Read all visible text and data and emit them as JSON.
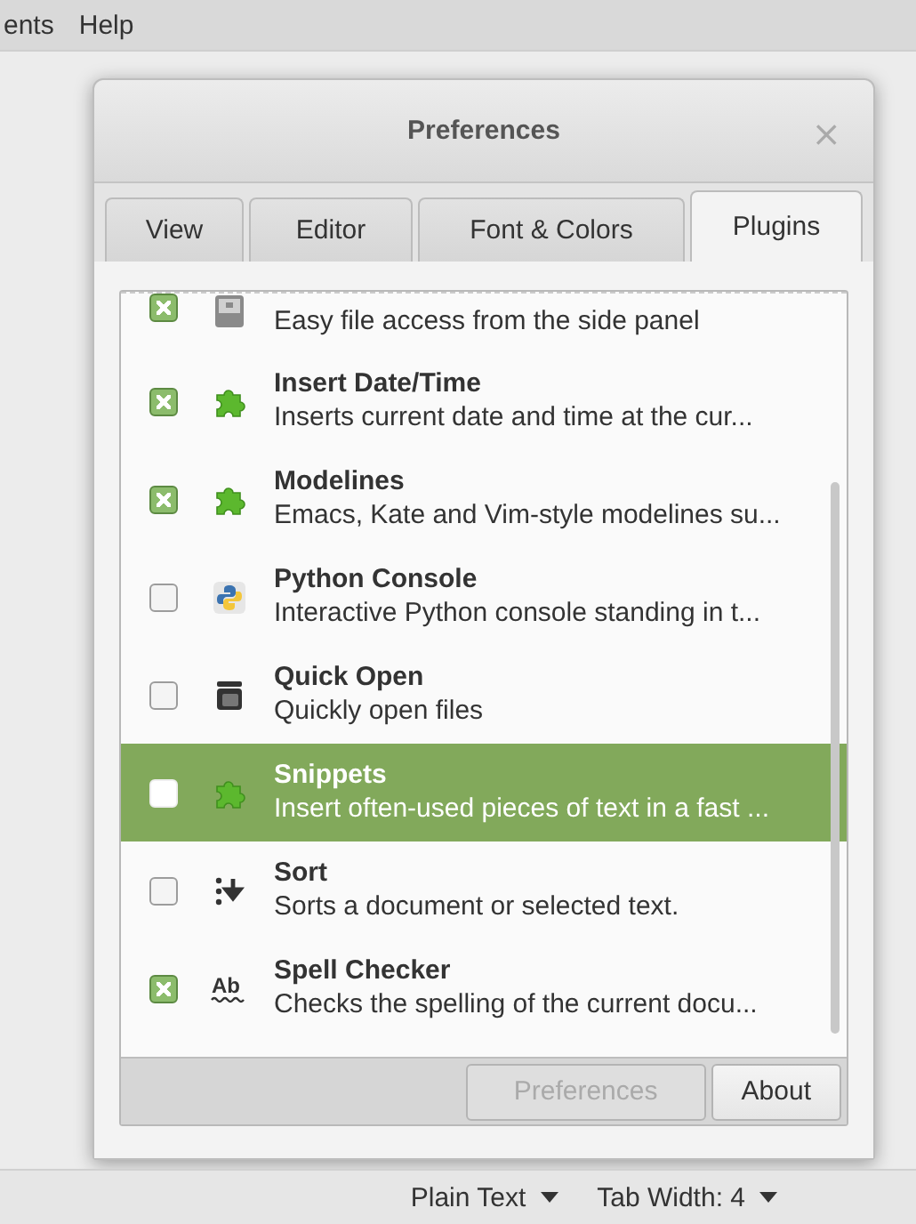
{
  "menu_bar": {
    "items": [
      "ents",
      "Help"
    ]
  },
  "dialog": {
    "title": "Preferences",
    "close": "×",
    "tabs": [
      {
        "label": "View",
        "selected": false
      },
      {
        "label": "Editor",
        "selected": false
      },
      {
        "label": "Font & Colors",
        "selected": false
      },
      {
        "label": "Plugins",
        "selected": true
      }
    ],
    "plugins": [
      {
        "kind": "panel",
        "description": "Easy file access from the side panel",
        "checked": true,
        "selected": false
      },
      {
        "kind": "puzzle",
        "name": "Insert Date/Time",
        "description": "Inserts current date and time at the cur...",
        "checked": true,
        "selected": false
      },
      {
        "kind": "puzzle",
        "name": "Modelines",
        "description": "Emacs, Kate and Vim-style modelines su...",
        "checked": true,
        "selected": false
      },
      {
        "kind": "python",
        "name": "Python Console",
        "description": "Interactive Python console standing in t...",
        "checked": false,
        "selected": false
      },
      {
        "kind": "windows",
        "name": "Quick Open",
        "description": "Quickly open files",
        "checked": false,
        "selected": false
      },
      {
        "kind": "puzzle",
        "name": "Snippets",
        "description": "Insert often-used pieces of text in a fast ...",
        "checked": false,
        "selected": true
      },
      {
        "kind": "sort",
        "name": "Sort",
        "description": "Sorts a document or selected text.",
        "checked": false,
        "selected": false
      },
      {
        "kind": "spell",
        "icon_label": "Ab",
        "name": "Spell Checker",
        "description": "Checks the spelling of the current docu...",
        "checked": true,
        "selected": false
      }
    ],
    "buttons": [
      {
        "label": "Preferences",
        "disabled": true
      },
      {
        "label": "About",
        "disabled": false
      }
    ]
  },
  "status_bar": {
    "items": [
      "Plain Text",
      "Tab Width: 4"
    ]
  }
}
